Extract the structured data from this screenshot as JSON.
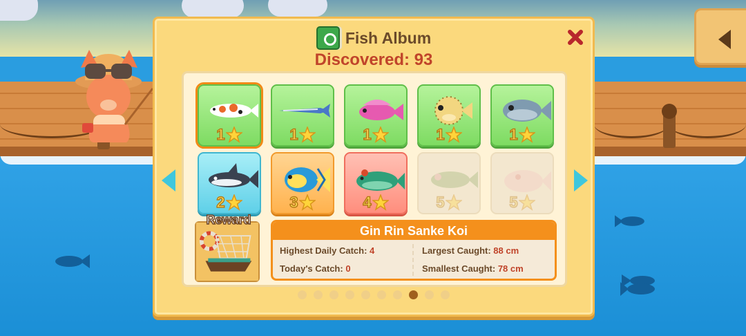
{
  "album": {
    "title": "Fish Album",
    "discovered": "Discovered: 93",
    "close_icon": "close-x-icon",
    "book_icon": "album-book-icon"
  },
  "fish_cards": [
    {
      "name": "koi",
      "stars": "1",
      "color": "green",
      "selected": true
    },
    {
      "name": "needlefish",
      "stars": "1",
      "color": "green"
    },
    {
      "name": "pink-fish",
      "stars": "1",
      "color": "green"
    },
    {
      "name": "pufferfish",
      "stars": "1",
      "color": "green"
    },
    {
      "name": "grey-fish",
      "stars": "1",
      "color": "green"
    },
    {
      "name": "shark",
      "stars": "2",
      "color": "blue"
    },
    {
      "name": "angelfish",
      "stars": "3",
      "color": "orange"
    },
    {
      "name": "green-fish",
      "stars": "4",
      "color": "red"
    },
    {
      "name": "bass",
      "stars": "5",
      "color": "locked"
    },
    {
      "name": "white-fish",
      "stars": "5",
      "color": "locked"
    }
  ],
  "reward": {
    "label": "Reward"
  },
  "selected_fish": {
    "name": "Gin Rin Sanke Koi",
    "highest_daily_label": "Highest Daily Catch:",
    "highest_daily_value": "4",
    "todays_label": "Today's Catch:",
    "todays_value": "0",
    "largest_label": "Largest Caught:",
    "largest_value": "88 cm",
    "smallest_label": "Smallest Caught:",
    "smallest_value": "78 cm"
  },
  "pagination": {
    "pages": 10,
    "active": 8
  },
  "colors": {
    "accent": "#f4901c",
    "value": "#c0442a",
    "panel": "#fbd97d"
  }
}
